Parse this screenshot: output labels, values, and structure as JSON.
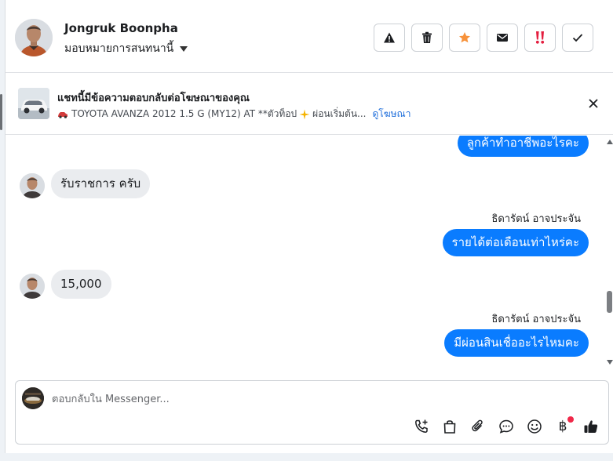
{
  "header": {
    "contact_name": "Jongruk Boonpha",
    "assign_label": "มอบหมายการสนทนานี้",
    "actions": [
      "warning-icon",
      "trash-icon",
      "star-icon",
      "envelope-icon",
      "double-exclamation-icon",
      "check-icon"
    ],
    "star_color": "#f7923b",
    "exclaim_color": "#e41e3f"
  },
  "ad": {
    "title": "แชทนี้มีข้อความตอบกลับต่อโฆษณาของคุณ",
    "subtitle": "TOYOTA AVANZA 2012 1.5 G (MY12) AT **ตัวท็อป",
    "subtitle_tail": "ผ่อนเริ่มต้น...",
    "link": "ดูโฆษณา"
  },
  "messages": [
    {
      "direction": "out",
      "text": "ลูกค้าทำอาชีพอะไรคะ"
    },
    {
      "direction": "in",
      "text": "รับราชการ ครับ"
    },
    {
      "direction": "out",
      "sender": "ธิดารัตน์ อาจประจัน",
      "text": "รายได้ต่อเดือนเท่าไหร่คะ"
    },
    {
      "direction": "in",
      "text": "15,000"
    },
    {
      "direction": "out",
      "sender": "ธิดารัตน์ อาจประจัน",
      "text": "มีผ่อนสินเชื่ออะไรไหมคะ"
    }
  ],
  "composer": {
    "placeholder": "ตอบกลับใน Messenger...",
    "tools": [
      "phone-plus-icon",
      "shopping-bag-icon",
      "paperclip-icon",
      "saved-reply-icon",
      "emoji-icon",
      "baht-icon",
      "thumbs-up-icon"
    ],
    "baht_symbol": "฿"
  },
  "colors": {
    "outgoing_bubble": "#0a7cff",
    "incoming_bubble": "#eaecef",
    "link": "#216fdb",
    "notification_dot": "#f02849"
  }
}
